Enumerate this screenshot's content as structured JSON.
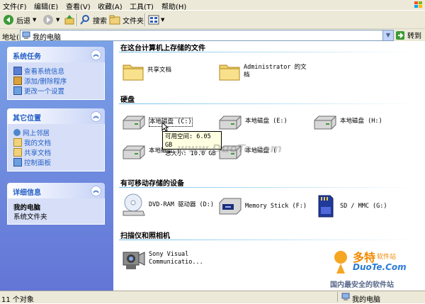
{
  "menubar": {
    "items": [
      "文件(F)",
      "编辑(E)",
      "查看(V)",
      "收藏(A)",
      "工具(T)",
      "帮助(H)"
    ]
  },
  "toolbar": {
    "back_label": "后退",
    "search_label": "搜索",
    "folders_label": "文件夹"
  },
  "address": {
    "label": "地址(D)",
    "value": "我的电脑",
    "go_label": "转到"
  },
  "left_panel": {
    "system_tasks": {
      "title": "系统任务",
      "links": [
        "查看系统信息",
        "添加/删除程序",
        "更改一个设置"
      ]
    },
    "other_places": {
      "title": "其它位置",
      "links": [
        "网上邻居",
        "我的文档",
        "共享文档",
        "控制面板"
      ]
    },
    "details": {
      "title": "详细信息",
      "name": "我的电脑",
      "type": "系统文件夹"
    }
  },
  "groups": {
    "stored_files": {
      "title": "在这台计算机上存储的文件",
      "items": [
        "共享文档",
        "Administrator 的文",
        "档"
      ]
    },
    "hard_drives": {
      "title": "硬盘",
      "items": [
        "本地磁盘 (C:)",
        "本地磁盘 (E:)",
        "本地磁盘 (H:)",
        "本地磁盘 (",
        "本地磁盘 ("
      ]
    },
    "removable": {
      "title": "有可移动存储的设备",
      "items": [
        "DVD-RAM 驱动器 (D:)",
        "Memory Stick (F:)",
        "SD / MMC (G:)"
      ]
    },
    "scanners": {
      "title": "扫描仪和照相机",
      "items": [
        "Sony Visual",
        "Communicatio..."
      ]
    }
  },
  "tooltip": {
    "free": "可用空间: 6.05 GB",
    "total": "总大小: 10.0 GB"
  },
  "statusbar": {
    "count": "11 个对象",
    "location": "我的电脑"
  },
  "watermark": {
    "brand": "多特",
    "brand_sub": "软件站",
    "url": "DuoTe.Com",
    "slogan": "国内最安全的软件站",
    "center": "www.DuoTe.com"
  }
}
